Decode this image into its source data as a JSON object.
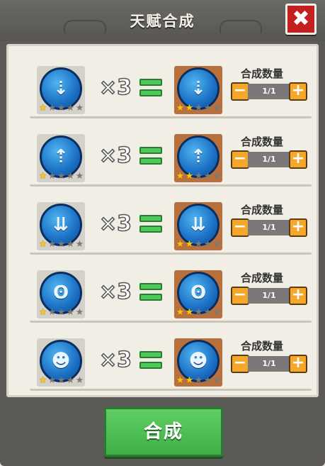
{
  "header": {
    "title": "天赋合成",
    "close_symbol": "✖"
  },
  "rows": [
    {
      "icon": "arrow-down-shark-talent-icon",
      "glyph": "⇣",
      "multiplier": "×3",
      "qty_label": "合成数量",
      "qty_value": "1/1",
      "src_stars": 1,
      "dst_stars": 2
    },
    {
      "icon": "coin-arrow-up-talent-icon",
      "glyph": "⇡",
      "multiplier": "×3",
      "qty_label": "合成数量",
      "qty_value": "1/1",
      "src_stars": 1,
      "dst_stars": 2
    },
    {
      "icon": "ice-wing-talent-icon",
      "glyph": "⇊",
      "multiplier": "×3",
      "qty_label": "合成数量",
      "qty_value": "1/1",
      "src_stars": 1,
      "dst_stars": 2
    },
    {
      "icon": "frost-face-talent-icon",
      "glyph": "ʘ",
      "multiplier": "×3",
      "qty_label": "合成数量",
      "qty_value": "1/1",
      "src_stars": 1,
      "dst_stars": 2
    },
    {
      "icon": "ice-warrior-talent-icon",
      "glyph": "☻",
      "multiplier": "×3",
      "qty_label": "合成数量",
      "qty_value": "1/1",
      "src_stars": 1,
      "dst_stars": 2
    }
  ],
  "stepper": {
    "minus": "−",
    "plus": "+"
  },
  "merge_button": "合成"
}
